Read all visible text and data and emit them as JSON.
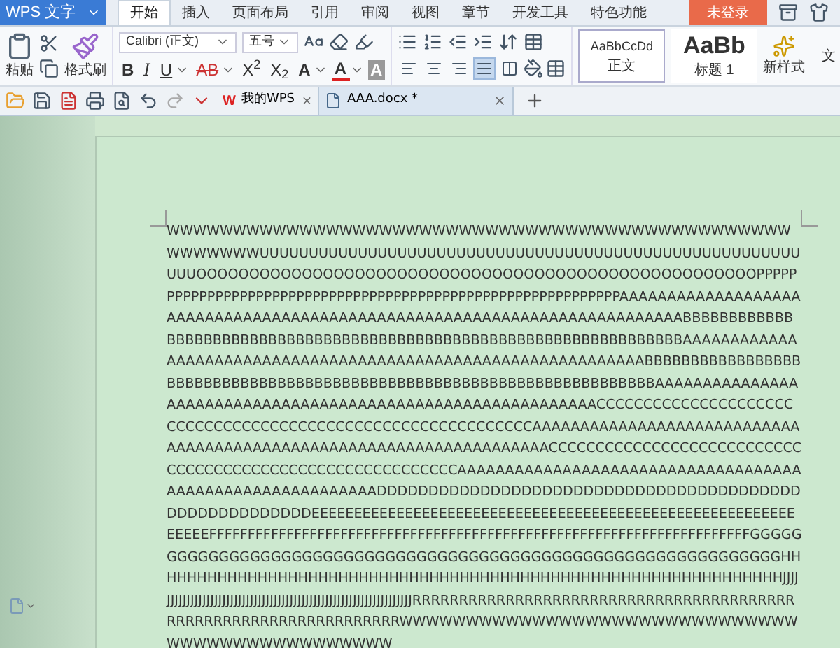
{
  "app_menu": {
    "label": "WPS 文字"
  },
  "tabs": [
    {
      "label": "开始",
      "selected": true
    },
    {
      "label": "插入",
      "selected": false
    },
    {
      "label": "页面布局",
      "selected": false
    },
    {
      "label": "引用",
      "selected": false
    },
    {
      "label": "审阅",
      "selected": false
    },
    {
      "label": "视图",
      "selected": false
    },
    {
      "label": "章节",
      "selected": false
    },
    {
      "label": "开发工具",
      "selected": false
    },
    {
      "label": "特色功能",
      "selected": false
    }
  ],
  "login_button": {
    "label": "未登录"
  },
  "clipboard": {
    "paste": "粘贴",
    "format_painter": "格式刷"
  },
  "font": {
    "name": "Calibri (正文)",
    "size": "五号"
  },
  "format_buttons": [
    {
      "label": "B",
      "kind": "bold",
      "caret": false
    },
    {
      "label": "I",
      "kind": "italic",
      "caret": false
    },
    {
      "label": "U",
      "kind": "underline",
      "caret": true
    },
    {
      "label": "AB",
      "kind": "strike",
      "caret": true
    },
    {
      "label": "X$^{2}$",
      "kind": "plain",
      "caret": false
    },
    {
      "label": "X$_{2}$",
      "kind": "plain",
      "caret": false
    },
    {
      "label": "A",
      "kind": "effect",
      "caret": true
    },
    {
      "label": "A",
      "kind": "color",
      "caret": true
    },
    {
      "label": "A",
      "kind": "shade",
      "caret": false
    }
  ],
  "align_buttons": [
    {
      "selected": false
    },
    {
      "selected": false
    },
    {
      "selected": false
    },
    {
      "selected": true
    },
    {
      "selected": false
    }
  ],
  "styles": [
    {
      "preview": "AaBbCcDd",
      "name": "正文",
      "kind": "body",
      "selected": true
    },
    {
      "preview": "AaBb",
      "name": "标题 1",
      "kind": "heading",
      "selected": false
    }
  ],
  "new_style": {
    "label": "新样式"
  },
  "edge_label": "文",
  "doc_tabs": [
    {
      "label": "我的WPS",
      "logo": "W",
      "kind": "home",
      "selected": false
    },
    {
      "label": "AAA.docx *",
      "kind": "doc",
      "selected": true
    }
  ],
  "document": {
    "text": "WWWWWWWWWWWWWWWWWWWWWWWWWWWWWWWWWWWWWWWWWWWWWWWWWWWWWWUUUUUUUUUUUUUUUUUUUUUUUUUUUUUUUUUUUUUUUUUUUUUUUUUUUUUUUUUUOOOOOOOOOOOOOOOOOOOOOOOOOOOOOOOOOOOOOOOOOOOOOOOOOOOOOPPPPPPPPPPPPPPPPPPPPPPPPPPPPPPPPPPPPPPPPPPPPPPPPPPPPPPPPPPPPPAAAAAAAAAAAAAAAAAAAAAAAAAAAAAAAAAAAAAAAAAAAAAAAAAAAAAAAAAAAAAAAAAAAAAAAAABBBBBBBBBBBBBBBBBBBBBBBBBBBBBBBBBBBBBBBBBBBBBBBBBBBBBBBBBBBBBBBBBBBBAAAAAAAAAAAAAAAAAAAAAAAAAAAAAAAAAAAAAAAAAAAAAAAAAAAAAAAAAAAAAABBBBBBBBBBBBBBBBBBBBBBBBBBBBBBBBBBBBBBBBBBBBBBBBBBBBBBBBBBBBBBBBBBBBBBAAAAAAAAAAAAAAAAAAAAAAAAAAAAAAAAAAAAAAAAAAAAAAAAAAAAAAAAAAAACCCCCCCCCCCCCCCCCCCCCCCCCCCCCCCCCCCCCCCCCCCCCCCCCCCCCCCCCCCCAAAAAAAAAAAAAAAAAAAAAAAAAAAAAAAAAAAAAAAAAAAAAAAAAAAAAAAAAAAAAAAAAAAACCCCCCCCCCCCCCCCCCCCCCCCCCCCCCCCCCCCCCCCCCCCCCCCCCCCCCCCCCAAAAAAAAAAAAAAAAAAAAAAAAAAAAAAAAAAAAAAAAAAAAAAAAAAAAAAAAAADDDDDDDDDDDDDDDDDDDDDDDDDDDDDDDDDDDDDDDDDDDDDDDDDDDDDDDEEEEEEEEEEEEEEEEEEEEEEEEEEEEEEEEEEEEEEEEEEEEEEEEEEEEEEEEEEEEEEFFFFFFFFFFFFFFFFFFFFFFFFFFFFFFFFFFFFFFFFFFFFFFFFFFFFFFFFFFFFFFFFFFFFFFGGGGGGGGGGGGGGGGGGGGGGGGGGGGGGGGGGGGGGGGGGGGGGGGGGGGGGGGGGGGGGGGHHHHHHHHHHHHHHHHHHHHHHHHHHHHHHHHHHHHHHHHHHHHHHHHHHHHHHHHHHHHHHHJJJJJJJJJJJJJJJJJJJJJJJJJJJJJJJJJJJJJJJJJJJJJJJJJJJJJJJJJJJJJJJJJJRRRRRRRRRRRRRRRRRRRRRRRRRRRRRRRRRRRRRRRRRRRRRRRRRRRRRRRRRRRRRRRRRRWWWWWWWWWWWWWWWWWWWWWWWWWWWWWWWWWWWWWWWWWWWWWWW"
  }
}
